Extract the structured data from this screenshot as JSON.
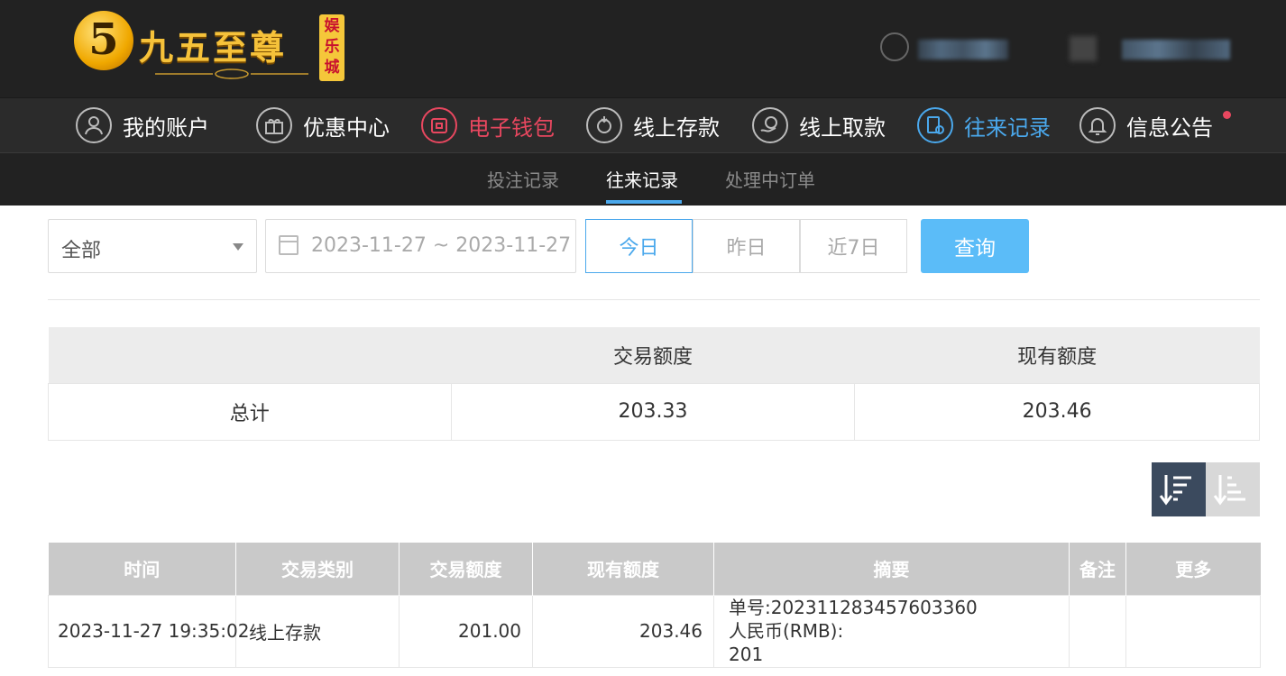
{
  "header": {
    "logo_text": "九五至尊",
    "logo_tag": "娱乐城",
    "logo_badge": "5"
  },
  "nav": {
    "items": [
      {
        "label": "我的账户",
        "icon": "user-icon"
      },
      {
        "label": "优惠中心",
        "icon": "gift-icon"
      },
      {
        "label": "电子钱包",
        "icon": "wallet-icon"
      },
      {
        "label": "线上存款",
        "icon": "deposit-icon"
      },
      {
        "label": "线上取款",
        "icon": "withdraw-icon"
      },
      {
        "label": "往来记录",
        "icon": "records-icon"
      },
      {
        "label": "信息公告",
        "icon": "bell-icon"
      }
    ],
    "active_color": "#4aa8ec",
    "wallet_color": "#e8475f"
  },
  "subnav": {
    "tabs": [
      "投注记录",
      "往来记录",
      "处理中订单"
    ],
    "active_index": 1
  },
  "filters": {
    "select_value": "全部",
    "date_range": "2023-11-27 ~ 2023-11-27",
    "quick": [
      "今日",
      "昨日",
      "近7日"
    ],
    "quick_active_index": 0,
    "query_label": "查询"
  },
  "summary": {
    "headers": [
      "",
      "交易额度",
      "现有额度"
    ],
    "row": [
      "总计",
      "203.33",
      "203.46"
    ]
  },
  "records": {
    "headers": [
      "时间",
      "交易类别",
      "交易额度",
      "现有额度",
      "摘要",
      "备注",
      "更多"
    ],
    "rows": [
      {
        "time": "2023-11-27 19:35:02",
        "type": "线上存款",
        "amount": "201.00",
        "balance": "203.46",
        "summary_lines": [
          "单号:202311283457603360",
          "人民币(RMB):",
          "201"
        ],
        "note": "",
        "more": ""
      }
    ]
  }
}
